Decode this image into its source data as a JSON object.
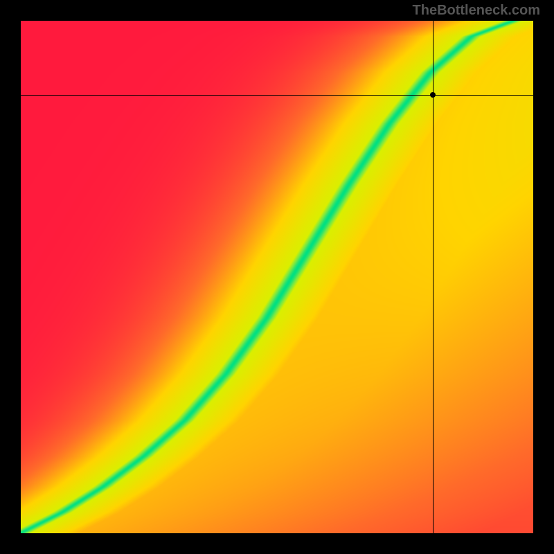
{
  "watermark": "TheBottleneck.com",
  "chart_data": {
    "type": "heatmap",
    "title": "",
    "xlabel": "",
    "ylabel": "",
    "xlim": [
      0,
      1
    ],
    "ylim": [
      0,
      1
    ],
    "colormap": {
      "name": "red-yellow-green",
      "stops": [
        {
          "pos": 0.0,
          "color": "#ff1a3d"
        },
        {
          "pos": 0.25,
          "color": "#ff6a2a"
        },
        {
          "pos": 0.5,
          "color": "#ffd400"
        },
        {
          "pos": 0.72,
          "color": "#d9f000"
        },
        {
          "pos": 0.88,
          "color": "#6fe84a"
        },
        {
          "pos": 1.0,
          "color": "#00e082"
        }
      ]
    },
    "crosshair": {
      "x": 0.805,
      "y": 0.855
    },
    "optimal_curve_description": "Green optimal ridge follows a concave-up path from bottom-left to upper-right; curve bows right in lower third then rises steeply.",
    "optimal_curve_samples": [
      {
        "x": 0.0,
        "y": 0.0
      },
      {
        "x": 0.08,
        "y": 0.04
      },
      {
        "x": 0.16,
        "y": 0.09
      },
      {
        "x": 0.24,
        "y": 0.15
      },
      {
        "x": 0.32,
        "y": 0.22
      },
      {
        "x": 0.4,
        "y": 0.31
      },
      {
        "x": 0.48,
        "y": 0.42
      },
      {
        "x": 0.56,
        "y": 0.55
      },
      {
        "x": 0.64,
        "y": 0.68
      },
      {
        "x": 0.72,
        "y": 0.8
      },
      {
        "x": 0.8,
        "y": 0.9
      },
      {
        "x": 0.88,
        "y": 0.97
      },
      {
        "x": 0.96,
        "y": 1.0
      }
    ],
    "ridge_halfwidth": 0.035,
    "falloff_sharpness": 6.0,
    "corner_values_estimate": {
      "top_left": 0.05,
      "top_right": 0.55,
      "bottom_left": 0.95,
      "bottom_right": 0.02
    }
  }
}
